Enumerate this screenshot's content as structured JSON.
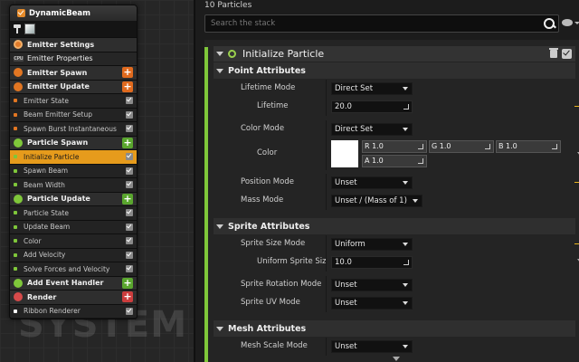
{
  "system": {
    "emitter_name": "DynamicBeam",
    "watermark": "SYSTEM",
    "rows": [
      {
        "label": "Emitter Settings",
        "kind": "group",
        "icon": "settings-icon",
        "action": "none"
      },
      {
        "label": "Emitter Properties",
        "kind": "group-sub",
        "icon": "cpu-icon",
        "action": "none",
        "badge": "CPU"
      },
      {
        "label": "Emitter Spawn",
        "kind": "group",
        "icon": "emitter-spawn-icon",
        "action": "add-orange"
      },
      {
        "label": "Emitter Update",
        "kind": "group",
        "icon": "emitter-update-icon",
        "action": "add-orange"
      },
      {
        "label": "Emitter State",
        "kind": "module",
        "dot": "#e27622"
      },
      {
        "label": "Beam Emitter Setup",
        "kind": "module",
        "dot": "#e27622"
      },
      {
        "label": "Spawn Burst Instantaneous",
        "kind": "module",
        "dot": "#e27622"
      },
      {
        "label": "Particle Spawn",
        "kind": "group",
        "icon": "particle-spawn-icon",
        "action": "add-green"
      },
      {
        "label": "Initialize Particle",
        "kind": "module",
        "dot": "#7fc73a",
        "selected": true
      },
      {
        "label": "Spawn Beam",
        "kind": "module",
        "dot": "#7fc73a"
      },
      {
        "label": "Beam Width",
        "kind": "module",
        "dot": "#7fc73a"
      },
      {
        "label": "Particle Update",
        "kind": "group",
        "icon": "particle-update-icon",
        "action": "add-green"
      },
      {
        "label": "Particle State",
        "kind": "module",
        "dot": "#7fc73a"
      },
      {
        "label": "Update Beam",
        "kind": "module",
        "dot": "#7fc73a"
      },
      {
        "label": "Color",
        "kind": "module",
        "dot": "#7fc73a"
      },
      {
        "label": "Add Velocity",
        "kind": "module",
        "dot": "#7fc73a"
      },
      {
        "label": "Solve Forces and Velocity",
        "kind": "module",
        "dot": "#7fc73a"
      },
      {
        "label": "Add Event Handler",
        "kind": "group",
        "icon": "event-handler-icon",
        "action": "add-green"
      },
      {
        "label": "Render",
        "kind": "group",
        "icon": "render-icon",
        "action": "add-red"
      },
      {
        "label": "Ribbon Renderer",
        "kind": "module",
        "dot": "#ffffff"
      }
    ]
  },
  "details": {
    "particle_count": "10 Particles",
    "search_placeholder": "Search the stack",
    "module_title": "Initialize Particle",
    "point_attributes": {
      "title": "Point Attributes",
      "lifetime_mode_label": "Lifetime Mode",
      "lifetime_mode_value": "Direct Set",
      "lifetime_label": "Lifetime",
      "lifetime_value": "20.0",
      "color_mode_label": "Color Mode",
      "color_mode_value": "Direct Set",
      "color_label": "Color",
      "color_r": "R  1.0",
      "color_g": "G  1.0",
      "color_b": "B  1.0",
      "color_a": "A  1.0",
      "position_mode_label": "Position Mode",
      "position_mode_value": "Unset",
      "mass_mode_label": "Mass Mode",
      "mass_mode_value": "Unset / (Mass of 1)"
    },
    "sprite_attributes": {
      "title": "Sprite Attributes",
      "sprite_size_mode_label": "Sprite Size Mode",
      "sprite_size_mode_value": "Uniform",
      "uniform_sprite_size_label": "Uniform Sprite Size",
      "uniform_sprite_size_value": "10.0",
      "sprite_rotation_mode_label": "Sprite Rotation Mode",
      "sprite_rotation_mode_value": "Unset",
      "sprite_uv_mode_label": "Sprite UV Mode",
      "sprite_uv_mode_value": "Unset"
    },
    "mesh_attributes": {
      "title": "Mesh Attributes",
      "mesh_scale_mode_label": "Mesh Scale Mode",
      "mesh_scale_mode_value": "Unset"
    }
  }
}
